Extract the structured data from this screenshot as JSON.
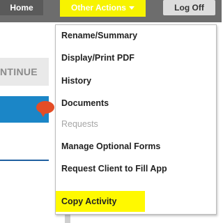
{
  "nav": {
    "home_label": "Home",
    "other_actions_label": "Other Actions",
    "log_off_label": "Log Off"
  },
  "background": {
    "continue_text": "NTINUE"
  },
  "menu": {
    "items": [
      {
        "label": "Rename/Summary"
      },
      {
        "label": "Display/Print PDF"
      },
      {
        "label": "History"
      },
      {
        "label": "Documents"
      },
      {
        "label": "Requests"
      },
      {
        "label": "Manage Optional Forms"
      },
      {
        "label": "Request Client to Fill App"
      },
      {
        "label": "Copy Activity"
      }
    ]
  },
  "colors": {
    "highlight": "#fff900",
    "nav_bar": "#6d6d6d",
    "blue_bar": "#1b86c7"
  }
}
